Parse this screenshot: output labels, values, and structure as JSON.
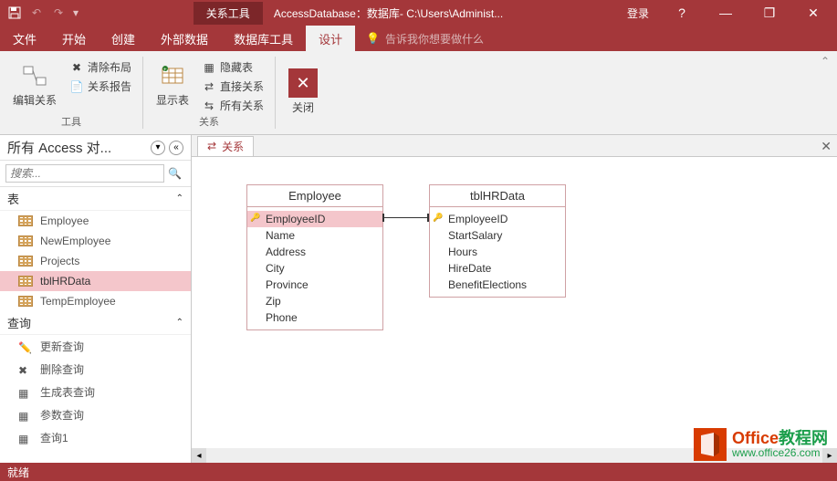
{
  "titlebar": {
    "contextual_tab": "关系工具",
    "title": "AccessDatabase：数据库- C:\\Users\\Administ...",
    "login": "登录",
    "help": "?"
  },
  "ribbon_tabs": [
    "文件",
    "开始",
    "创建",
    "外部数据",
    "数据库工具",
    "设计"
  ],
  "tellme": "告诉我你想要做什么",
  "ribbon": {
    "group1": {
      "big_btn": "编辑关系",
      "small1": "清除布局",
      "small2": "关系报告",
      "label": "工具"
    },
    "group2": {
      "big_btn": "显示表",
      "small1": "隐藏表",
      "small2": "直接关系",
      "small3": "所有关系",
      "label": "关系"
    },
    "group3": {
      "big_btn": "关闭"
    }
  },
  "nav": {
    "title": "所有 Access 对...",
    "search_placeholder": "搜索...",
    "section_tables": "表",
    "tables": [
      "Employee",
      "NewEmployee",
      "Projects",
      "tblHRData",
      "TempEmployee"
    ],
    "selected_table": "tblHRData",
    "section_queries": "查询",
    "queries": [
      "更新查询",
      "删除查询",
      "生成表查询",
      "参数查询",
      "查询1"
    ]
  },
  "doc_tab": "关系",
  "entities": {
    "employee": {
      "title": "Employee",
      "fields": [
        "EmployeeID",
        "Name",
        "Address",
        "City",
        "Province",
        "Zip",
        "Phone"
      ]
    },
    "hrdata": {
      "title": "tblHRData",
      "fields": [
        "EmployeeID",
        "StartSalary",
        "Hours",
        "HireDate",
        "BenefitElections"
      ]
    }
  },
  "statusbar": "就绪",
  "watermark": {
    "title_part1": "Office",
    "title_part2": "教程网",
    "url": "www.office26.com"
  }
}
